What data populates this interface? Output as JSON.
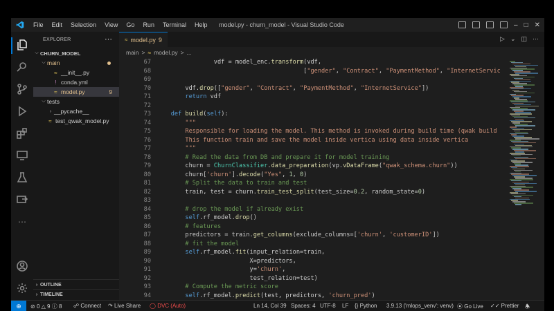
{
  "titlebar": {
    "menu": [
      "File",
      "Edit",
      "Selection",
      "View",
      "Go",
      "Run",
      "Terminal",
      "Help"
    ],
    "title": "model.py - churn_model - Visual Studio Code"
  },
  "sidebar": {
    "header": "EXPLORER",
    "project": "CHURN_MODEL",
    "items": [
      {
        "label": "main",
        "kind": "folder"
      },
      {
        "label": "__init__.py",
        "kind": "file"
      },
      {
        "label": "conda.yml",
        "kind": "file"
      },
      {
        "label": "model.py",
        "kind": "file",
        "badge": "9"
      },
      {
        "label": "tests",
        "kind": "folder"
      },
      {
        "label": "__pycache__",
        "kind": "folder"
      },
      {
        "label": "test_qwak_model.py",
        "kind": "file"
      }
    ],
    "outline": "OUTLINE",
    "timeline": "TIMELINE"
  },
  "editor": {
    "tab_label": "model.py",
    "tab_badge": "9",
    "breadcrumb": [
      "main",
      ">",
      "model.py",
      ">",
      "..."
    ],
    "lines": [
      {
        "n": "67",
        "text": "                vdf = model_enc.transform(vdf,"
      },
      {
        "n": "68",
        "text": "                                         [\"gender\", \"Contract\", \"PaymentMethod\", \"InternetService\"])"
      },
      {
        "n": "69",
        "text": ""
      },
      {
        "n": "70",
        "text": "        vdf.drop([\"gender\", \"Contract\", \"PaymentMethod\", \"InternetService\"])"
      },
      {
        "n": "71",
        "text": "        return vdf"
      },
      {
        "n": "72",
        "text": ""
      },
      {
        "n": "73",
        "text": "    def build(self):"
      },
      {
        "n": "74",
        "text": "        \"\"\""
      },
      {
        "n": "75",
        "text": "        Responsible for loading the model. This method is invoked during build time (qwak build comm"
      },
      {
        "n": "76",
        "text": "        This function train and save the model inside vertica using data inside vertica"
      },
      {
        "n": "77",
        "text": "        \"\"\""
      },
      {
        "n": "78",
        "text": "        # Read the data from DB and prepare it for model training"
      },
      {
        "n": "79",
        "text": "        churn = ChurnClassifier.data_preparation(vp.vDataFrame(\"qwak_schema.churn\"))"
      },
      {
        "n": "80",
        "text": "        churn['churn'].decode(\"Yes\", 1, 0)"
      },
      {
        "n": "81",
        "text": "        # Split the data to train and test"
      },
      {
        "n": "82",
        "text": "        train, test = churn.train_test_split(test_size=0.2, random_state=0)"
      },
      {
        "n": "83",
        "text": ""
      },
      {
        "n": "84",
        "text": "        # drop the model if already exist"
      },
      {
        "n": "85",
        "text": "        self.rf_model.drop()"
      },
      {
        "n": "86",
        "text": "        # features"
      },
      {
        "n": "87",
        "text": "        predictors = train.get_columns(exclude_columns=['churn', 'customerID'])"
      },
      {
        "n": "88",
        "text": "        # fit the model"
      },
      {
        "n": "89",
        "text": "        self.rf_model.fit(input_relation=train,"
      },
      {
        "n": "90",
        "text": "                          X=predictors,"
      },
      {
        "n": "91",
        "text": "                          y='churn',"
      },
      {
        "n": "92",
        "text": "                          test_relation=test)"
      },
      {
        "n": "93",
        "text": "        # Compute the metric score"
      },
      {
        "n": "94",
        "text": "        self.rf_model.predict(test, predictors, 'churn_pred')"
      }
    ]
  },
  "statusbar": {
    "errors": "0",
    "warnings": "9",
    "info": "8",
    "connect": "Connect",
    "live_share": "Live Share",
    "dvc": "DVC (Auto)",
    "position": "Ln 14, Col 39",
    "spaces": "Spaces: 4",
    "encoding": "UTF-8",
    "eol": "LF",
    "language": "Python",
    "interpreter": "3.9.13 ('mlops_venv': venv)",
    "go_live": "Go Live",
    "prettier": "Prettier"
  },
  "colors": {
    "accent": "#0078d4",
    "modified": "#e2c08d",
    "dvc": "#f14c4c"
  }
}
